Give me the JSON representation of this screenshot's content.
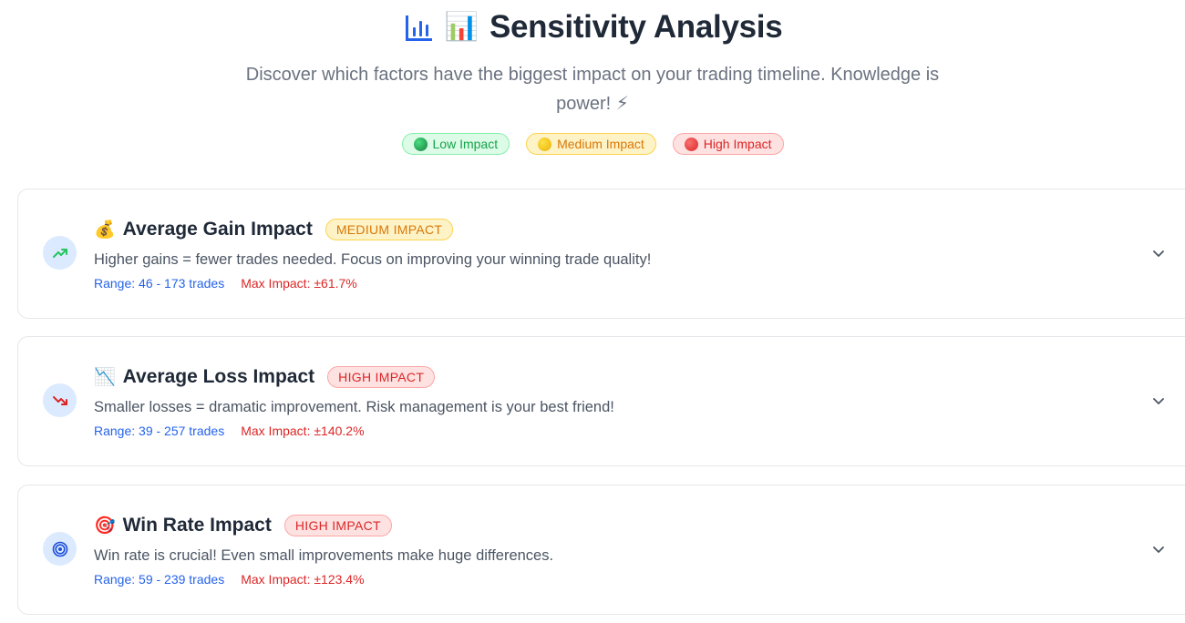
{
  "header": {
    "title": "Sensitivity Analysis",
    "title_emoji": "📊",
    "subtitle": "Discover which factors have the biggest impact on your trading timeline. Knowledge is power! ⚡"
  },
  "legend": [
    {
      "label": "Low Impact",
      "color": "#16a34a"
    },
    {
      "label": "Medium Impact",
      "color": "#d97706"
    },
    {
      "label": "High Impact",
      "color": "#dc2626"
    }
  ],
  "cards": [
    {
      "emoji": "💰",
      "title": "Average Gain Impact",
      "badge": "MEDIUM IMPACT",
      "icon": "trending-up-icon",
      "description": "Higher gains = fewer trades needed. Focus on improving your winning trade quality!",
      "range": "Range: 46 - 173 trades",
      "max_impact": "Max Impact: ±61.7%"
    },
    {
      "emoji": "📉",
      "title": "Average Loss Impact",
      "badge": "HIGH IMPACT",
      "icon": "trending-down-icon",
      "description": "Smaller losses = dramatic improvement. Risk management is your best friend!",
      "range": "Range: 39 - 257 trades",
      "max_impact": "Max Impact: ±140.2%"
    },
    {
      "emoji": "🎯",
      "title": "Win Rate Impact",
      "badge": "HIGH IMPACT",
      "icon": "target-icon",
      "description": "Win rate is crucial! Even small improvements make huge differences.",
      "range": "Range: 59 - 239 trades",
      "max_impact": "Max Impact: ±123.4%"
    }
  ],
  "colors": {
    "accent_blue": "#2563eb",
    "medium": "#d97706",
    "high": "#dc2626",
    "low": "#16a34a"
  }
}
